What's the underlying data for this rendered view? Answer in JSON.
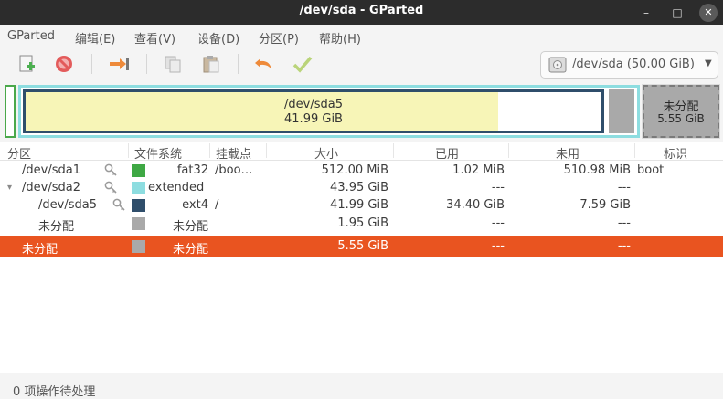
{
  "window": {
    "title": "/dev/sda - GParted"
  },
  "menu": [
    "GParted",
    "编辑(E)",
    "查看(V)",
    "设备(D)",
    "分区(P)",
    "帮助(H)"
  ],
  "toolbar": {
    "icons": [
      "new-partition-icon",
      "delete-icon",
      "resize-move-icon",
      "copy-icon",
      "paste-icon",
      "undo-icon",
      "apply-icon"
    ],
    "device": "/dev/sda (50.00 GiB)"
  },
  "partition_map": {
    "sda5_name": "/dev/sda5",
    "sda5_size": "41.99 GiB",
    "sda5_used_fraction": 0.82,
    "unalloc_label": "未分配",
    "unalloc_size": "5.55 GiB"
  },
  "table": {
    "headers": {
      "partition": "分区",
      "filesystem": "文件系统",
      "mountpoint": "挂载点",
      "size": "大小",
      "used": "已用",
      "unused": "未用",
      "flags": "标识"
    },
    "rows": [
      {
        "partition": "/dev/sda1",
        "fs": "fat32",
        "mount": "/boo…",
        "size": "512.00 MiB",
        "used": "1.02 MiB",
        "unused": "510.98 MiB",
        "flags": "boot"
      },
      {
        "partition": "/dev/sda2",
        "fs": "extended",
        "mount": "",
        "size": "43.95 GiB",
        "used": "---",
        "unused": "---",
        "flags": ""
      },
      {
        "partition": "/dev/sda5",
        "fs": "ext4",
        "mount": "/",
        "size": "41.99 GiB",
        "used": "34.40 GiB",
        "unused": "7.59 GiB",
        "flags": ""
      },
      {
        "partition": "未分配",
        "fs": "未分配",
        "mount": "",
        "size": "1.95 GiB",
        "used": "---",
        "unused": "---",
        "flags": ""
      },
      {
        "partition": "未分配",
        "fs": "未分配",
        "mount": "",
        "size": "5.55 GiB",
        "used": "---",
        "unused": "---",
        "flags": ""
      }
    ]
  },
  "colors": {
    "fat32": "#3ea844",
    "extended": "#8ddde0",
    "ext4": "#2f4e6b",
    "unallocated": "#a9a9a9",
    "selection": "#e95420"
  },
  "status": {
    "text": "0 项操作待处理"
  }
}
